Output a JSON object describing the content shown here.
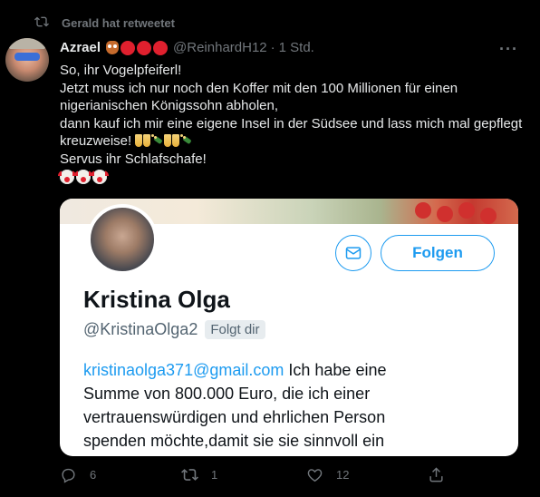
{
  "retweet": {
    "label": "Gerald hat retweetet"
  },
  "tweet": {
    "author_name": "Azrael",
    "author_handle": "@ReinhardH12",
    "separator": "·",
    "time": "1 Std.",
    "lines": [
      "So, ihr Vogelpfeiferl!",
      "Jetzt muss ich nur noch den Koffer mit den 100 Millionen für einen",
      "nigerianischen Königssohn abholen,",
      "dann kauf ich mir eine eigene Insel in der Südsee und lass mich mal gepflegt",
      "kreuzweise!",
      "Servus ihr Schlafschafe!"
    ]
  },
  "card": {
    "name": "Kristina Olga",
    "handle": "@KristinaOlga2",
    "follows_you": "Folgt dir",
    "follow_label": "Folgen",
    "bio_link": "kristinaolga371@gmail.com",
    "bio_lines": [
      "Ich habe eine",
      "Summe von 800.000 Euro, die ich einer",
      "vertrauenswürdigen und ehrlichen Person",
      "spenden möchte,damit sie sie sinnvoll ein"
    ]
  },
  "actions": {
    "replies": "6",
    "retweets": "1",
    "likes": "12"
  },
  "icons": {
    "retweet_indicator": "retweet-icon",
    "more": "more-icon",
    "mail": "mail-icon",
    "reply": "reply-icon",
    "retweet": "retweet-icon",
    "like": "heart-icon",
    "share": "share-icon"
  },
  "colors": {
    "background": "#000000",
    "text": "#e7e9ea",
    "muted": "#71767b",
    "accent": "#1d9bf0"
  }
}
